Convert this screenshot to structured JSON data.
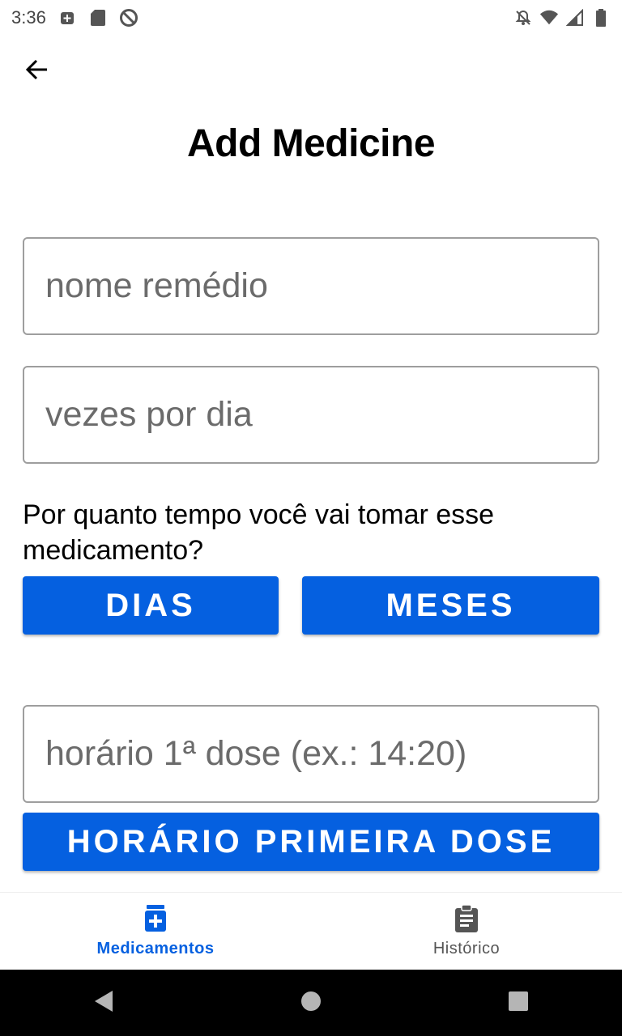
{
  "status_bar": {
    "time": "3:36",
    "left_icons": [
      "medical-notification-icon",
      "sd-card-icon",
      "no-sync-icon"
    ],
    "right_icons": [
      "notifications-off-icon",
      "wifi-icon",
      "signal-icon",
      "battery-icon"
    ]
  },
  "header": {
    "back_icon": "arrow-back-icon",
    "title": "Add Medicine"
  },
  "form": {
    "medicine_name": {
      "placeholder": "nome remédio",
      "value": ""
    },
    "times_per_day": {
      "placeholder": "vezes por dia",
      "value": ""
    },
    "duration_question": "Por quanto tempo você vai tomar esse medicamento?",
    "days_button": "DIAS",
    "months_button": "MESES",
    "first_dose_time": {
      "placeholder": "horário 1ª dose (ex.: 14:20)",
      "value": ""
    },
    "first_dose_button": "HORÁRIO PRIMEIRA DOSE"
  },
  "bottom_nav": {
    "items": [
      {
        "label": "Medicamentos",
        "icon": "medicine-box-icon",
        "active": true
      },
      {
        "label": "Histórico",
        "icon": "clipboard-icon",
        "active": false
      }
    ]
  },
  "system_nav": {
    "icons": [
      "back-triangle-icon",
      "home-circle-icon",
      "recents-square-icon"
    ]
  },
  "colors": {
    "accent": "#0560e0",
    "field_border": "#9e9e9e",
    "placeholder": "#6b6b6b",
    "inactive_nav": "#555555"
  }
}
